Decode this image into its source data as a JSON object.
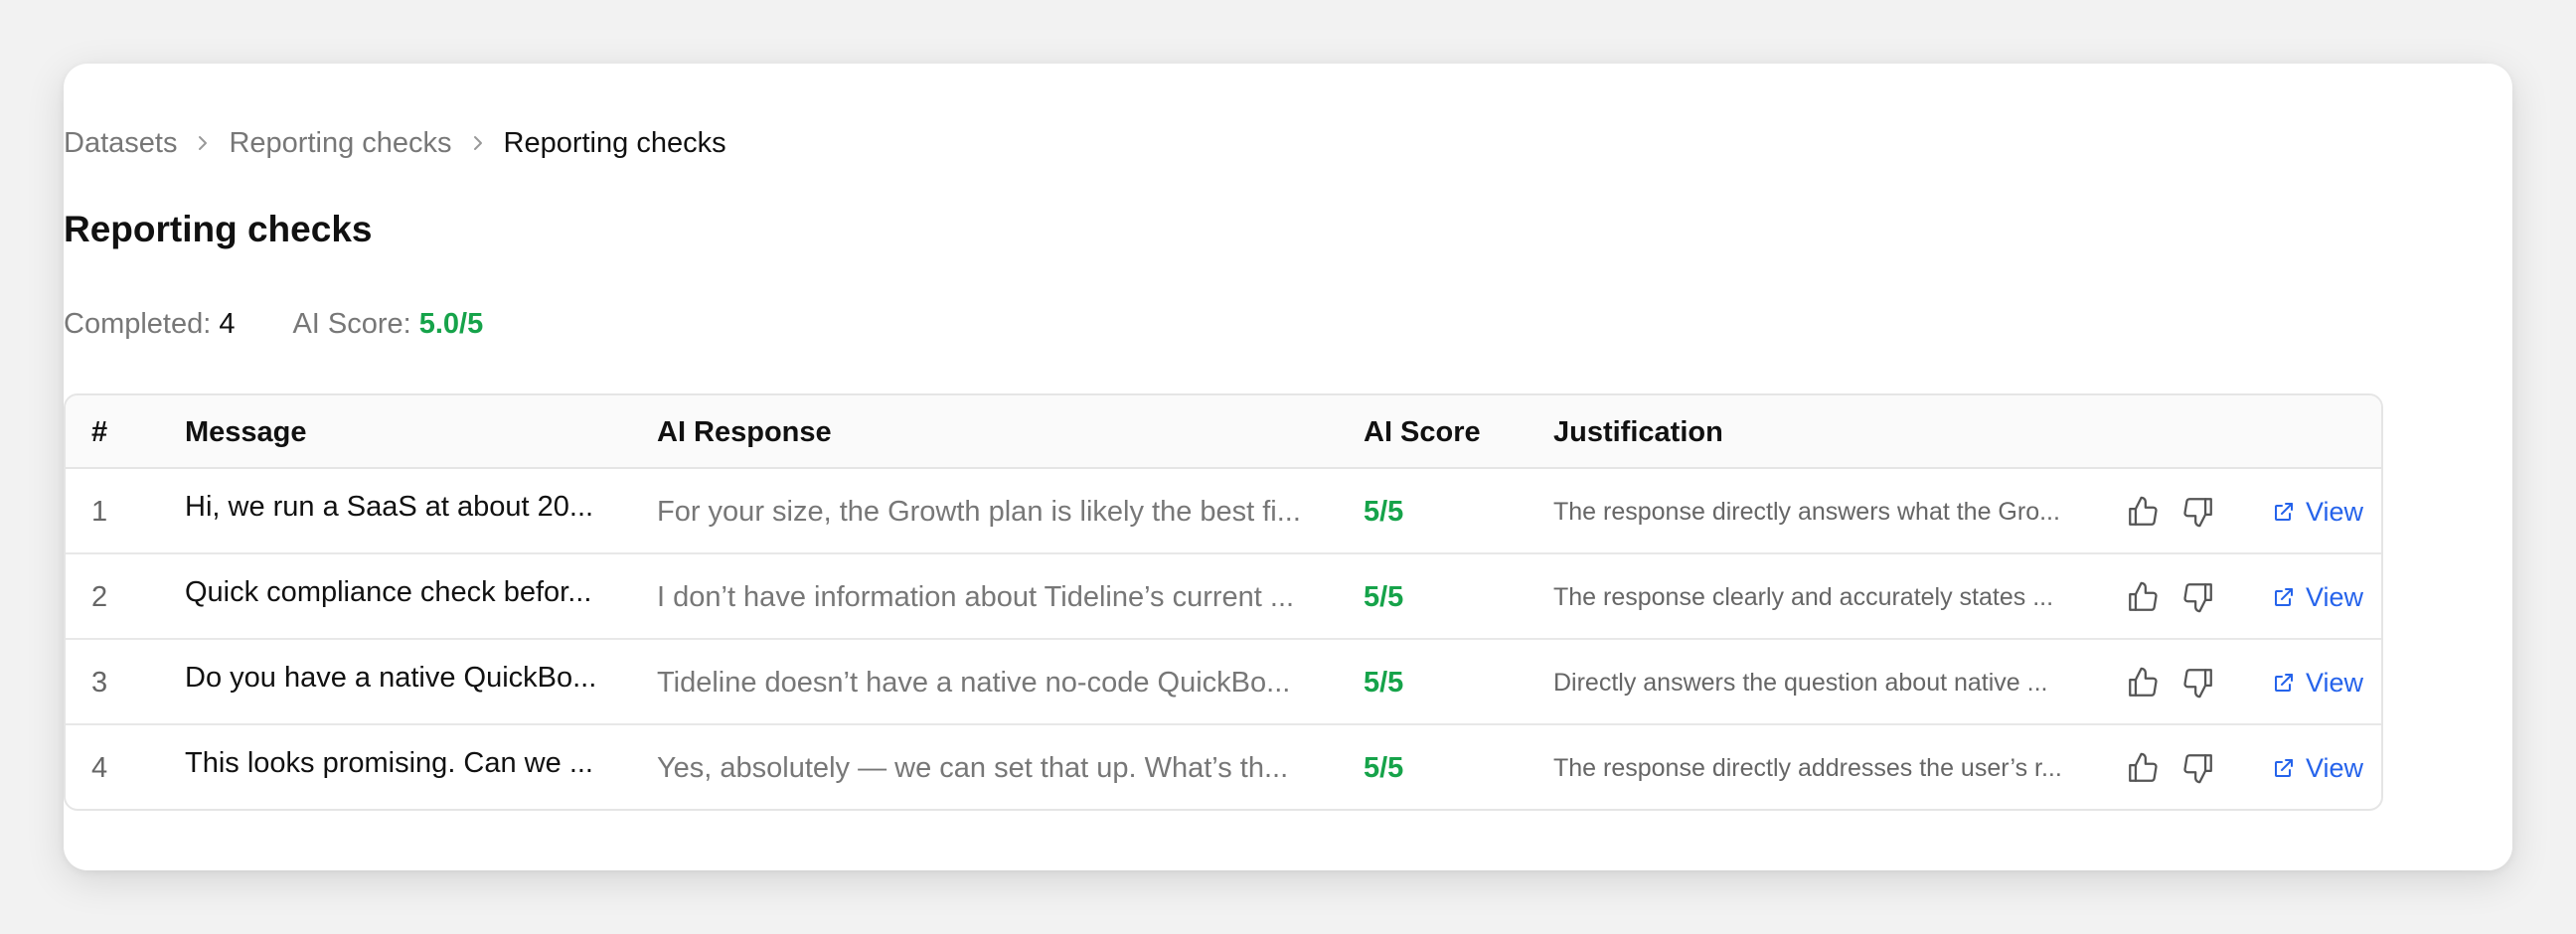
{
  "breadcrumb": [
    "Datasets",
    "Reporting checks",
    "Reporting checks"
  ],
  "title": "Reporting checks",
  "stats": {
    "completed_label": "Completed:",
    "completed_value": "4",
    "score_label": "AI Score:",
    "score_value": "5.0/5"
  },
  "table": {
    "headers": [
      "#",
      "Message",
      "AI Response",
      "AI Score",
      "Justification"
    ],
    "rows": [
      {
        "num": "1",
        "message": "Hi, we run a SaaS at about 20...",
        "response": "For your size, the Growth plan is likely the best fi...",
        "score": "5/5",
        "justification": "The response directly answers what the Gro...",
        "view": "View"
      },
      {
        "num": "2",
        "message": "Quick compliance check befor...",
        "response": "I don’t have information about Tideline’s current ...",
        "score": "5/5",
        "justification": "The response clearly and accurately states ...",
        "view": "View"
      },
      {
        "num": "3",
        "message": "Do you have a native QuickBo...",
        "response": "Tideline doesn’t have a native no-code QuickBo...",
        "score": "5/5",
        "justification": "Directly answers the question about native ...",
        "view": "View"
      },
      {
        "num": "4",
        "message": "This looks promising. Can we ...",
        "response": "Yes, absolutely — we can set that up. What’s th...",
        "score": "5/5",
        "justification": "The response directly addresses the user’s r...",
        "view": "View"
      }
    ]
  },
  "icons": {
    "separator": "chevron-right-icon",
    "like": "thumbs-up-icon",
    "dislike": "thumbs-down-icon",
    "view": "external-link-icon"
  },
  "colors": {
    "score": "#16a34a",
    "link": "#2563eb"
  }
}
